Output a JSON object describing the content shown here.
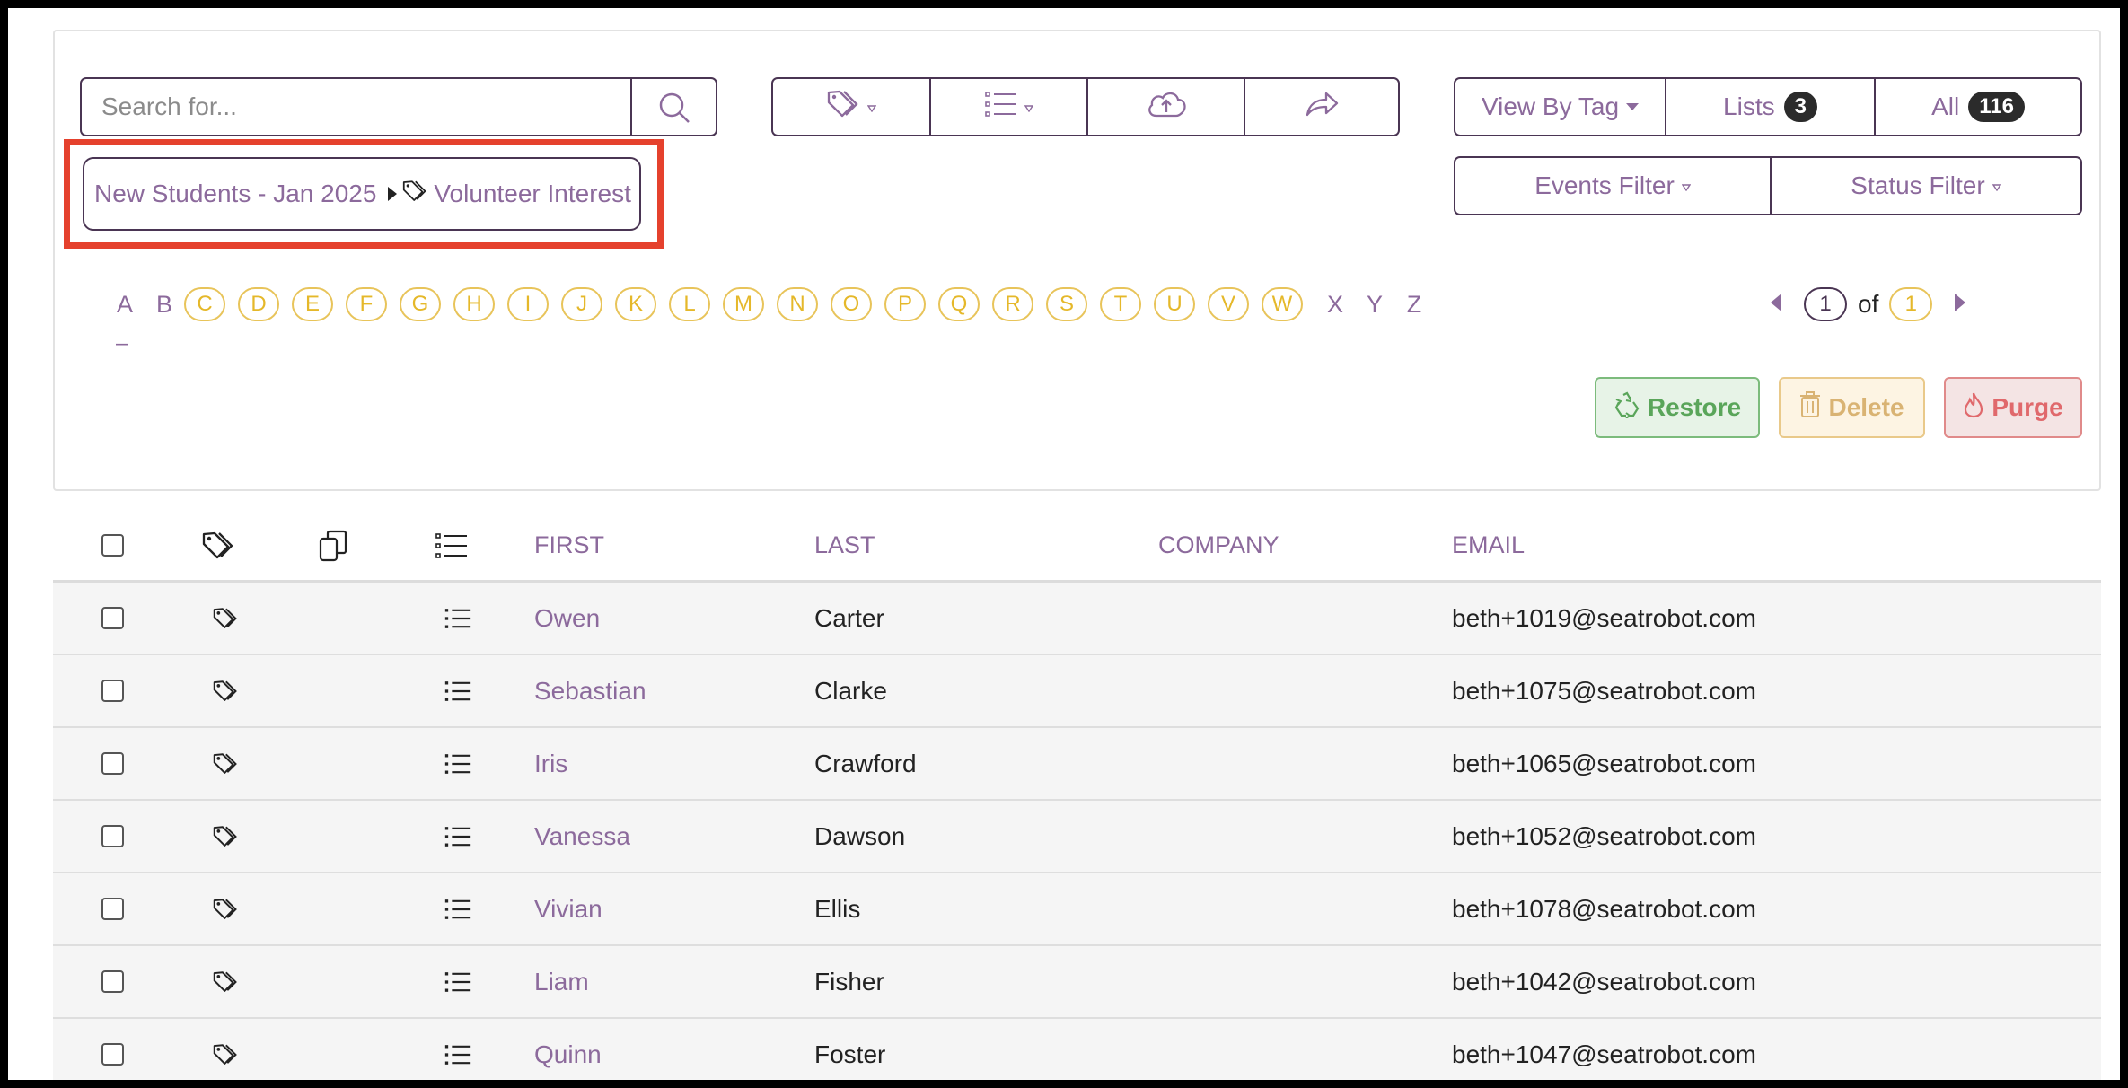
{
  "search": {
    "placeholder": "Search for..."
  },
  "toolbar": {
    "view_by_tag": "View By Tag",
    "lists_label": "Lists",
    "lists_count": "3",
    "all_label": "All",
    "all_count": "116",
    "events_filter": "Events Filter",
    "status_filter": "Status Filter"
  },
  "breadcrumb": {
    "list": "New Students - Jan 2025",
    "tag": "Volunteer Interest"
  },
  "alphabet": [
    {
      "l": "A",
      "active": false
    },
    {
      "l": "B",
      "active": false
    },
    {
      "l": "C",
      "active": true
    },
    {
      "l": "D",
      "active": true
    },
    {
      "l": "E",
      "active": true
    },
    {
      "l": "F",
      "active": true
    },
    {
      "l": "G",
      "active": true
    },
    {
      "l": "H",
      "active": true
    },
    {
      "l": "I",
      "active": true
    },
    {
      "l": "J",
      "active": true
    },
    {
      "l": "K",
      "active": true
    },
    {
      "l": "L",
      "active": true
    },
    {
      "l": "M",
      "active": true
    },
    {
      "l": "N",
      "active": true
    },
    {
      "l": "O",
      "active": true
    },
    {
      "l": "P",
      "active": true
    },
    {
      "l": "Q",
      "active": true
    },
    {
      "l": "R",
      "active": true
    },
    {
      "l": "S",
      "active": true
    },
    {
      "l": "T",
      "active": true
    },
    {
      "l": "U",
      "active": true
    },
    {
      "l": "V",
      "active": true
    },
    {
      "l": "W",
      "active": true
    },
    {
      "l": "X",
      "active": false
    },
    {
      "l": "Y",
      "active": false
    },
    {
      "l": "Z",
      "active": false
    }
  ],
  "dash": "–",
  "pager": {
    "current": "1",
    "of_label": "of",
    "total": "1"
  },
  "actions": {
    "restore": "Restore",
    "delete": "Delete",
    "purge": "Purge"
  },
  "table": {
    "headers": {
      "first": "FIRST",
      "last": "LAST",
      "company": "COMPANY",
      "email": "EMAIL"
    },
    "rows": [
      {
        "first": "Owen",
        "last": "Carter",
        "company": "",
        "email": "beth+1019@seatrobot.com"
      },
      {
        "first": "Sebastian",
        "last": "Clarke",
        "company": "",
        "email": "beth+1075@seatrobot.com"
      },
      {
        "first": "Iris",
        "last": "Crawford",
        "company": "",
        "email": "beth+1065@seatrobot.com"
      },
      {
        "first": "Vanessa",
        "last": "Dawson",
        "company": "",
        "email": "beth+1052@seatrobot.com"
      },
      {
        "first": "Vivian",
        "last": "Ellis",
        "company": "",
        "email": "beth+1078@seatrobot.com"
      },
      {
        "first": "Liam",
        "last": "Fisher",
        "company": "",
        "email": "beth+1042@seatrobot.com"
      },
      {
        "first": "Quinn",
        "last": "Foster",
        "company": "",
        "email": "beth+1047@seatrobot.com"
      }
    ]
  },
  "colors": {
    "accent": "#8c6a9c",
    "border": "#4a3553",
    "letter": "#e5b82a",
    "highlight": "#e5412d"
  }
}
